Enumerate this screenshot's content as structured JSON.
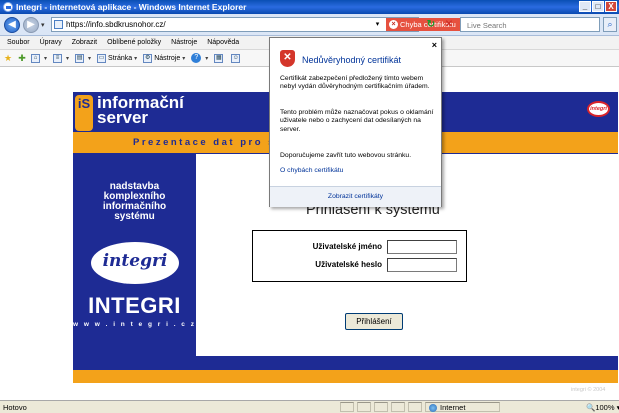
{
  "window": {
    "title": "Integri - internetová aplikace - Windows Internet Explorer",
    "minimize": "_",
    "maximize": "□",
    "close": "X"
  },
  "address_bar": {
    "url": "https://info.sbdkrusnohor.cz/",
    "certificate_error_label": "Chyba certifikátu",
    "search_placeholder": "Live Search"
  },
  "menu": {
    "items": [
      "Soubor",
      "Úpravy",
      "Zobrazit",
      "Oblíbené položky",
      "Nástroje",
      "Nápověda"
    ]
  },
  "toolbar": {
    "page_label": "Stránka",
    "tools_label": "Nástroje"
  },
  "site": {
    "logo_mark": "iS",
    "logo_text": "informační\nserver",
    "tagline": "Prezentace dat pro s                                 o fondu",
    "badge": "integri",
    "sidebar_text": "nadstavba\nkomplexního\ninformačního\nsystému",
    "script_logo": "integri",
    "brand": "INTEGRI",
    "brand_url": "w w w . i n t e g r i . c z",
    "heading": "Přihlášení k systému",
    "username_label": "Uživatelské jméno",
    "password_label": "Uživatelské heslo",
    "submit_label": "Přihlášení",
    "copyright": "integri © 2004"
  },
  "cert_popup": {
    "title": "Nedůvěryhodný certifikát",
    "close": "×",
    "paragraph1": "Certifikát zabezpečení předložený tímto webem nebyl vydán důvěryhodným certifikačním úřadem.",
    "paragraph2": "Tento problém může naznačovat pokus o oklamání uživatele nebo o zachycení dat odesílaných na server.",
    "paragraph3": "Doporučujeme zavřít tuto webovou stránku.",
    "link": "O chybách certifikátu",
    "footer_link": "Zobrazit certifikáty"
  },
  "status_bar": {
    "status": "Hotovo",
    "zone": "Internet",
    "zoom": "100%"
  },
  "colors": {
    "navy": "#1e2b94",
    "orange": "#f3a21a",
    "cert_error": "#e6513f",
    "link_blue": "#003399"
  }
}
